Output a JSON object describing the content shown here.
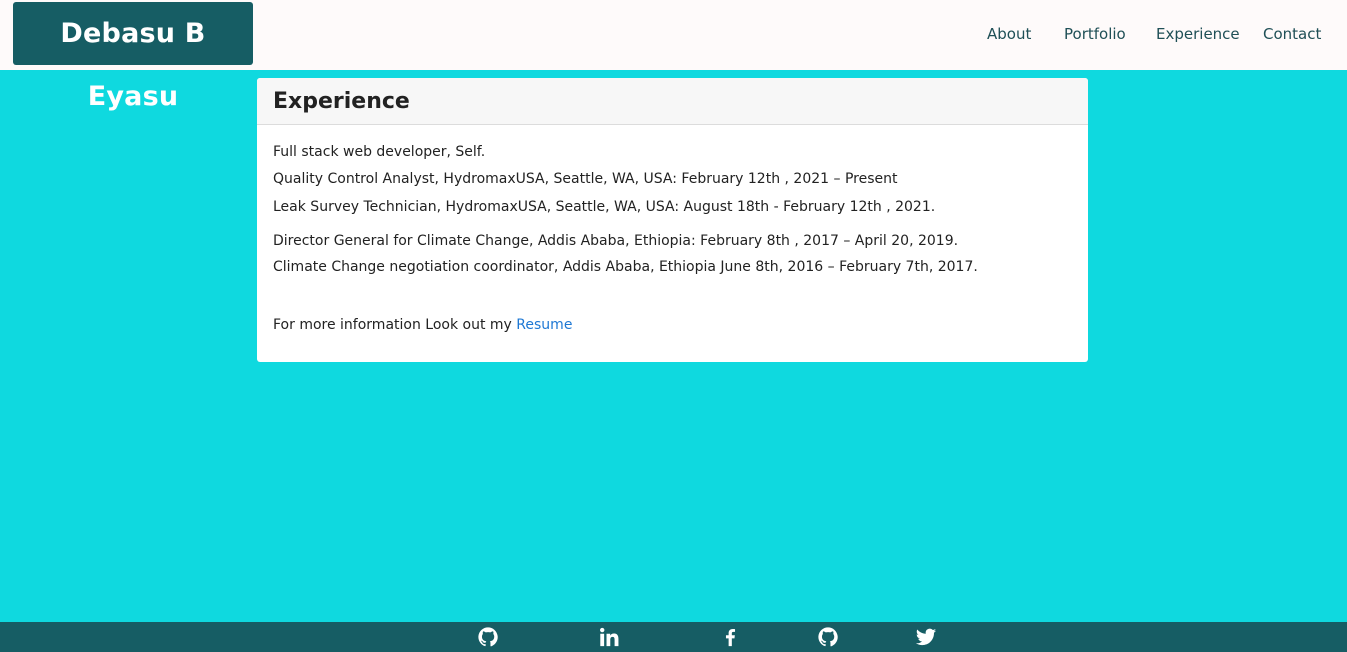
{
  "header": {
    "brand": "Debasu B Eyasu",
    "nav": [
      {
        "label": "About"
      },
      {
        "label": "Portfolio"
      },
      {
        "label": "Experience"
      },
      {
        "label": "Contact"
      }
    ]
  },
  "experience": {
    "title": "Experience",
    "items": [
      "Full stack web developer, Self.",
      "Quality Control Analyst, HydromaxUSA, Seattle, WA, USA: February 12th , 2021 – Present",
      "Leak Survey Technician, HydromaxUSA, Seattle, WA, USA: August 18th - February 12th , 2021.",
      "Director General for Climate Change, Addis Ababa, Ethiopia: February 8th , 2017 – April 20, 2019.",
      "Climate Change negotiation coordinator, Addis Ababa, Ethiopia June 8th, 2016 – February 7th, 2017."
    ],
    "more_info_text": "For more information Look out my ",
    "resume_label": "Resume"
  },
  "footer": {
    "icons": [
      "github-icon",
      "linkedin-icon",
      "facebook-icon",
      "github-icon",
      "twitter-icon"
    ]
  },
  "colors": {
    "page_background": "#0fd9df",
    "brand_background": "#165d64",
    "footer_background": "#165d64",
    "navbar_background": "#fefafa",
    "link_color": "#1e78d4"
  }
}
